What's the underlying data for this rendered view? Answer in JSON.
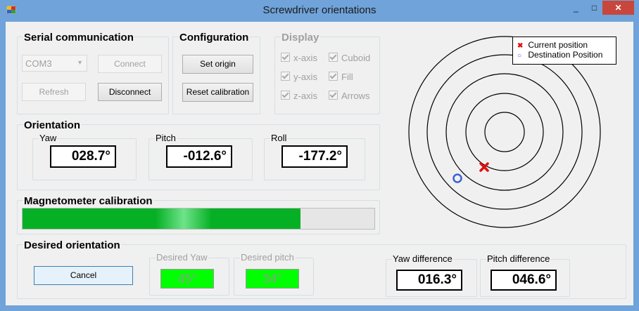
{
  "window": {
    "title": "Screwdriver orientations",
    "minimize": "_",
    "maximize": "□",
    "close": "✕"
  },
  "serial": {
    "title": "Serial communication",
    "port": "COM3",
    "connect": "Connect",
    "refresh": "Refresh",
    "disconnect": "Disconnect"
  },
  "config": {
    "title": "Configuration",
    "set_origin": "Set origin",
    "reset_calibration": "Reset calibration"
  },
  "display": {
    "title": "Display",
    "options": [
      {
        "label": "x-axis",
        "checked": true
      },
      {
        "label": "y-axis",
        "checked": true
      },
      {
        "label": "z-axis",
        "checked": true
      },
      {
        "label": "Cuboid",
        "checked": true
      },
      {
        "label": "Fill",
        "checked": true
      },
      {
        "label": "Arrows",
        "checked": true
      }
    ]
  },
  "orientation": {
    "title": "Orientation",
    "yaw": {
      "label": "Yaw",
      "value": "028.7°"
    },
    "pitch": {
      "label": "Pitch",
      "value": "-012.6°"
    },
    "roll": {
      "label": "Roll",
      "value": "-177.2°"
    }
  },
  "magnetometer": {
    "title": "Magnetometer calibration",
    "progress": 0.79
  },
  "desired": {
    "title": "Desired orientation",
    "cancel": "Cancel",
    "yaw": {
      "label": "Desired Yaw",
      "value": "45°"
    },
    "pitch": {
      "label": "Desired pitch",
      "value": "34°"
    },
    "yaw_diff": {
      "label": "Yaw difference",
      "value": "016.3°"
    },
    "pitch_diff": {
      "label": "Pitch difference",
      "value": "046.6°"
    }
  },
  "target_plot": {
    "legend": {
      "current": "Current position",
      "destination": "Destination Position"
    },
    "current_marker_color": "#e01010",
    "destination_marker_color": "#3a62d6"
  }
}
